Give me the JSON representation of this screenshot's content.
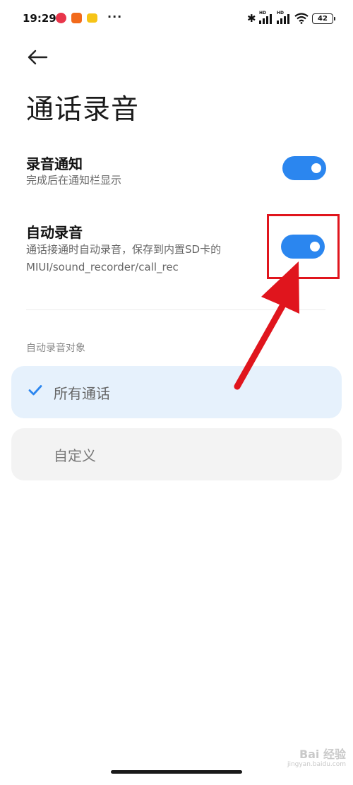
{
  "status_bar": {
    "time": "19:29",
    "more": "···",
    "signal_label": "HD",
    "battery": "42"
  },
  "header": {
    "title": "通话录音"
  },
  "settings": [
    {
      "title": "录音通知",
      "description": "完成后在通知栏显示",
      "enabled": true
    },
    {
      "title": "自动录音",
      "description_line1": "通话接通时自动录音，保存到内置SD卡的",
      "description_line2": "MIUI/sound_recorder/call_rec",
      "enabled": true
    }
  ],
  "section": {
    "label": "自动录音对象",
    "options": [
      {
        "label": "所有通话",
        "selected": true
      },
      {
        "label": "自定义",
        "selected": false
      }
    ]
  },
  "watermark": {
    "line1": "Bai 经验",
    "line2": "jingyan.baidu.com"
  },
  "colors": {
    "accent": "#2b86ef",
    "annotation": "#e0151d"
  }
}
